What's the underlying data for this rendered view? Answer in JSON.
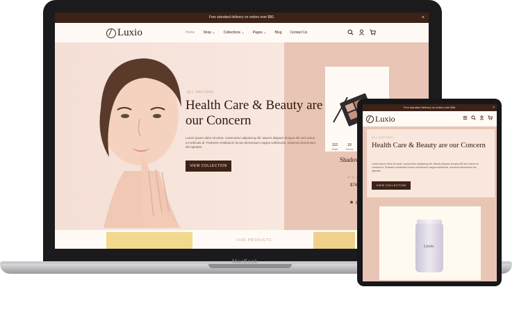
{
  "desktop": {
    "promo_text": "Free standard delivery on orders over $80.",
    "close": "×",
    "logo_text": "Luxio",
    "nav": [
      "Home",
      "Shop",
      "Collections",
      "Pages",
      "Blog",
      "Contact Us"
    ],
    "nav_suffix": [
      "",
      " ⌄",
      " ⌄",
      " ⌄",
      "",
      ""
    ],
    "icons": [
      "search-icon",
      "user-icon",
      "cart-icon"
    ],
    "hero": {
      "subtitle": "ALL NATURAL",
      "title": "Health Care & Beauty are our Concern",
      "body": "Lorem ipsum dolor sit amet, consectetur adipiscing elit. Mauris aliquam tempus elit sed varius mi vehicula id. Praesent vestibulum lectus elementum magna sollicitudin, euismod elementum dui egestas.",
      "button": "VIEW COLLECTION"
    },
    "product": {
      "countdown_values": [
        "312",
        "18"
      ],
      "countdown_labels": [
        "Days",
        "Hours"
      ],
      "name": "Shadow",
      "price": "$74.",
      "stars": "☆☆☆"
    },
    "section_title": "OUR PRODUCTS"
  },
  "macbook_label": "MacBook",
  "tablet": {
    "promo_text": "Free standard delivery on orders over $80.",
    "close": "×",
    "logo_text": "Luxio",
    "hero": {
      "subtitle": "ALL NATURAL",
      "title": "Health Care & Beauty are our Concern",
      "body": "Lorem ipsum dolor sit amet, consectetur adipiscing elit. Mauris aliquam tempus elit sed varius mi vehicula id. Praesent vestibulum lectus elementum magna sollicitudin, euismod elementum dui egestas.",
      "button": "VIEW COLLECTION"
    },
    "product_label": "Luxio"
  },
  "colors": {
    "brand_dark": "#3d2217",
    "hero_pink": "#e9c5b5",
    "cream": "#fffaf6"
  }
}
